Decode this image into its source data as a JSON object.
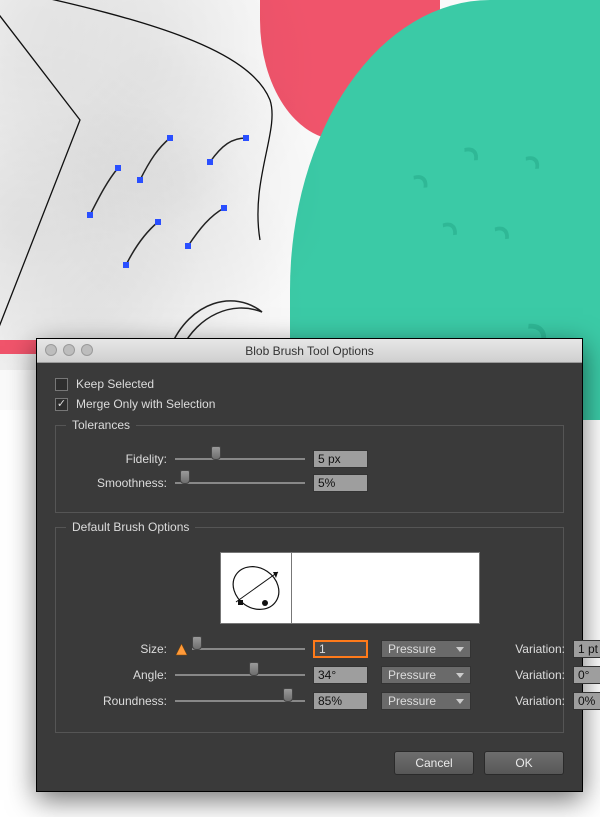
{
  "dialog": {
    "title": "Blob Brush Tool Options",
    "keep_selected": {
      "label": "Keep Selected",
      "checked": false
    },
    "merge_only": {
      "label": "Merge Only with Selection",
      "checked": true
    },
    "tolerances": {
      "legend": "Tolerances",
      "fidelity": {
        "label": "Fidelity:",
        "value": "5 px"
      },
      "smoothness": {
        "label": "Smoothness:",
        "value": "5%"
      }
    },
    "brush": {
      "legend": "Default Brush Options",
      "size": {
        "label": "Size:",
        "value": "1",
        "control": "Pressure",
        "variation_label": "Variation:",
        "variation": "1 pt",
        "warn": true
      },
      "angle": {
        "label": "Angle:",
        "value": "34°",
        "control": "Pressure",
        "variation_label": "Variation:",
        "variation": "0°"
      },
      "roundness": {
        "label": "Roundness:",
        "value": "85%",
        "control": "Pressure",
        "variation_label": "Variation:",
        "variation": "0%"
      }
    },
    "buttons": {
      "cancel": "Cancel",
      "ok": "OK"
    }
  },
  "colors": {
    "accent_green": "#3bcaa6",
    "accent_green_stroke": "#2fb896",
    "accent_pink": "#f0546b",
    "selection_blue": "#2a4fff",
    "dialog_bg": "#3a3a3a"
  }
}
